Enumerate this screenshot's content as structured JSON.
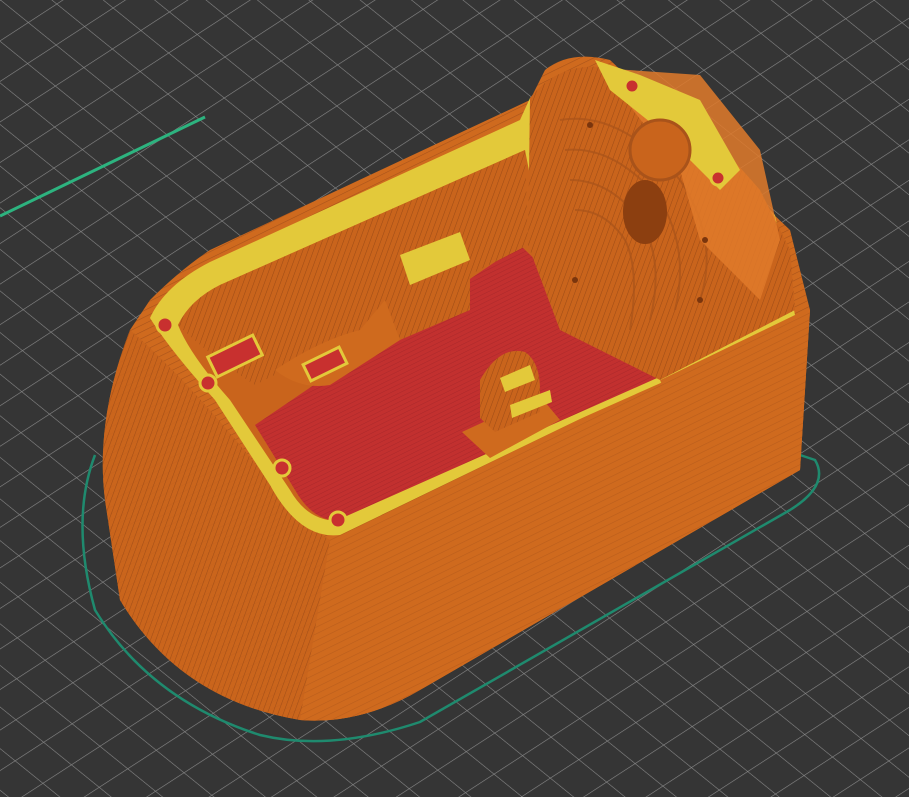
{
  "viewport": {
    "view": "3d-preview",
    "background_color": "#353535",
    "grid_color": "#8a8a8a"
  },
  "colors": {
    "perimeter": "#d2691e",
    "perimeter_dark": "#a84f14",
    "perimeter_light": "#e07a2a",
    "external_perimeter": "#e3c93a",
    "solid_infill": "#c8302f",
    "top_solid": "#b52a2a",
    "skirt": "#1f8a6e",
    "travel": "#2db37f"
  },
  "legend_items": [],
  "model": {
    "name": "",
    "icon": "printed-part-icon"
  }
}
